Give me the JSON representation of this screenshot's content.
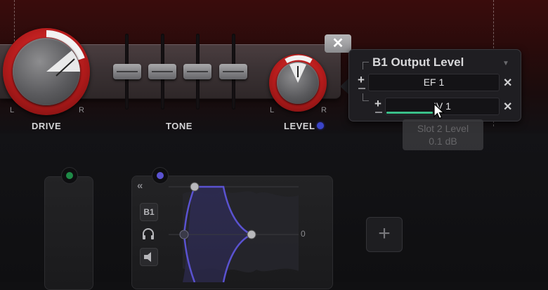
{
  "amp": {
    "drive": {
      "label": "DRIVE",
      "left": "L",
      "right": "R"
    },
    "tone": {
      "label": "TONE",
      "fader_count": 4
    },
    "level": {
      "label": "LEVEL",
      "left": "L",
      "right": "R"
    },
    "close_label": "✕"
  },
  "popup": {
    "title": "B1 Output Level",
    "slots": [
      {
        "name": "EF 1",
        "add": "+",
        "remove": "✕"
      },
      {
        "name": "IV 1",
        "add": "+",
        "remove": "✕"
      }
    ],
    "tooltip_line1": "Slot 2 Level",
    "tooltip_line2": "0.1 dB"
  },
  "mixer": {
    "collapse_label": "«",
    "b1_label": "B1",
    "headphones_icon": "headphones-icon",
    "speaker_icon": "speaker-icon",
    "zero_label": "0",
    "add_label": "+"
  },
  "colors": {
    "accent_red": "#c92222",
    "level_dot": "#3a44c8",
    "crossfade_purple": "#5a52d0",
    "green_node": "#1e8a47",
    "slot_level": "#3bbf8a"
  }
}
